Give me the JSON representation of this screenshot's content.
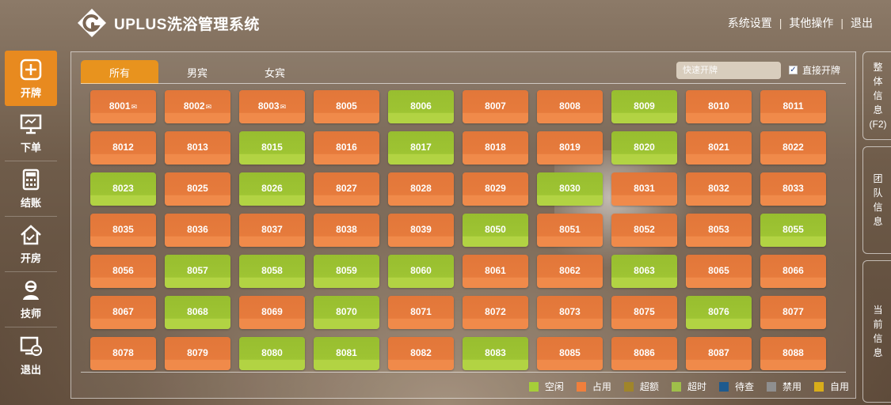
{
  "header": {
    "brand_title": "UPLUS洗浴管理系统",
    "menu": [
      "系统设置",
      "其他操作",
      "退出"
    ]
  },
  "sidebar": {
    "items": [
      {
        "label": "开牌",
        "icon": "plus-box-icon",
        "active": true
      },
      {
        "label": "下单",
        "icon": "monitor-icon",
        "active": false
      },
      {
        "label": "结账",
        "icon": "calculator-icon",
        "active": false
      },
      {
        "label": "开房",
        "icon": "house-icon",
        "active": false
      },
      {
        "label": "技师",
        "icon": "technician-icon",
        "active": false
      },
      {
        "label": "退出",
        "icon": "logout-icon",
        "active": false
      }
    ]
  },
  "tabs": [
    "所有",
    "男宾",
    "女宾"
  ],
  "active_tab": 0,
  "quick_open": {
    "placeholder": "快速开牌"
  },
  "direct_open": {
    "label": "直接开牌",
    "checked": true
  },
  "rooms": [
    {
      "id": "8001",
      "suffix": "✉",
      "status": "occupied"
    },
    {
      "id": "8002",
      "suffix": "✉",
      "status": "occupied"
    },
    {
      "id": "8003",
      "suffix": "✉",
      "status": "occupied"
    },
    {
      "id": "8005",
      "status": "occupied"
    },
    {
      "id": "8006",
      "status": "free"
    },
    {
      "id": "8007",
      "status": "occupied"
    },
    {
      "id": "8008",
      "status": "occupied"
    },
    {
      "id": "8009",
      "status": "free"
    },
    {
      "id": "8010",
      "status": "occupied"
    },
    {
      "id": "8011",
      "status": "occupied"
    },
    {
      "id": "8012",
      "status": "occupied"
    },
    {
      "id": "8013",
      "status": "occupied"
    },
    {
      "id": "8015",
      "status": "free"
    },
    {
      "id": "8016",
      "status": "occupied"
    },
    {
      "id": "8017",
      "status": "free"
    },
    {
      "id": "8018",
      "status": "occupied"
    },
    {
      "id": "8019",
      "status": "occupied"
    },
    {
      "id": "8020",
      "status": "free"
    },
    {
      "id": "8021",
      "status": "occupied"
    },
    {
      "id": "8022",
      "status": "occupied"
    },
    {
      "id": "8023",
      "status": "free"
    },
    {
      "id": "8025",
      "status": "occupied"
    },
    {
      "id": "8026",
      "status": "free"
    },
    {
      "id": "8027",
      "status": "occupied"
    },
    {
      "id": "8028",
      "status": "occupied"
    },
    {
      "id": "8029",
      "status": "occupied"
    },
    {
      "id": "8030",
      "status": "free"
    },
    {
      "id": "8031",
      "status": "occupied"
    },
    {
      "id": "8032",
      "status": "occupied"
    },
    {
      "id": "8033",
      "status": "occupied"
    },
    {
      "id": "8035",
      "status": "occupied"
    },
    {
      "id": "8036",
      "status": "occupied"
    },
    {
      "id": "8037",
      "status": "occupied"
    },
    {
      "id": "8038",
      "status": "occupied"
    },
    {
      "id": "8039",
      "status": "occupied"
    },
    {
      "id": "8050",
      "status": "free"
    },
    {
      "id": "8051",
      "status": "occupied"
    },
    {
      "id": "8052",
      "status": "occupied"
    },
    {
      "id": "8053",
      "status": "occupied"
    },
    {
      "id": "8055",
      "status": "free"
    },
    {
      "id": "8056",
      "status": "occupied"
    },
    {
      "id": "8057",
      "status": "free"
    },
    {
      "id": "8058",
      "status": "free"
    },
    {
      "id": "8059",
      "status": "free"
    },
    {
      "id": "8060",
      "status": "free"
    },
    {
      "id": "8061",
      "status": "occupied"
    },
    {
      "id": "8062",
      "status": "occupied"
    },
    {
      "id": "8063",
      "status": "free"
    },
    {
      "id": "8065",
      "status": "occupied"
    },
    {
      "id": "8066",
      "status": "occupied"
    },
    {
      "id": "8067",
      "status": "occupied"
    },
    {
      "id": "8068",
      "status": "free"
    },
    {
      "id": "8069",
      "status": "occupied"
    },
    {
      "id": "8070",
      "status": "free"
    },
    {
      "id": "8071",
      "status": "occupied"
    },
    {
      "id": "8072",
      "status": "occupied"
    },
    {
      "id": "8073",
      "status": "occupied"
    },
    {
      "id": "8075",
      "status": "occupied"
    },
    {
      "id": "8076",
      "status": "free"
    },
    {
      "id": "8077",
      "status": "occupied"
    },
    {
      "id": "8078",
      "status": "occupied"
    },
    {
      "id": "8079",
      "status": "occupied"
    },
    {
      "id": "8080",
      "status": "free"
    },
    {
      "id": "8081",
      "status": "free"
    },
    {
      "id": "8082",
      "status": "occupied"
    },
    {
      "id": "8083",
      "status": "free"
    },
    {
      "id": "8085",
      "status": "occupied"
    },
    {
      "id": "8086",
      "status": "occupied"
    },
    {
      "id": "8087",
      "status": "occupied"
    },
    {
      "id": "8088",
      "status": "occupied"
    }
  ],
  "legend": [
    {
      "label": "空闲",
      "color": "#a6ce39"
    },
    {
      "label": "占用",
      "color": "#f07f3c"
    },
    {
      "label": "超额",
      "color": "#a0852a"
    },
    {
      "label": "超时",
      "color": "#9fbf4a"
    },
    {
      "label": "待查",
      "color": "#1e5a8e"
    },
    {
      "label": "禁用",
      "color": "#8f8f8f"
    },
    {
      "label": "自用",
      "color": "#d8ad1a"
    }
  ],
  "right_panel": [
    {
      "lines": [
        "整",
        "体",
        "信",
        "息",
        "(F2)"
      ],
      "height": 112
    },
    {
      "lines": [
        "团",
        "队",
        "信",
        "息"
      ],
      "height": 136
    },
    {
      "lines": [
        "当",
        "前",
        "信",
        "息"
      ],
      "height": 180
    }
  ],
  "colors": {
    "accent": "#e8931e",
    "occupied": "#e67b3c",
    "free": "#9ec433"
  }
}
